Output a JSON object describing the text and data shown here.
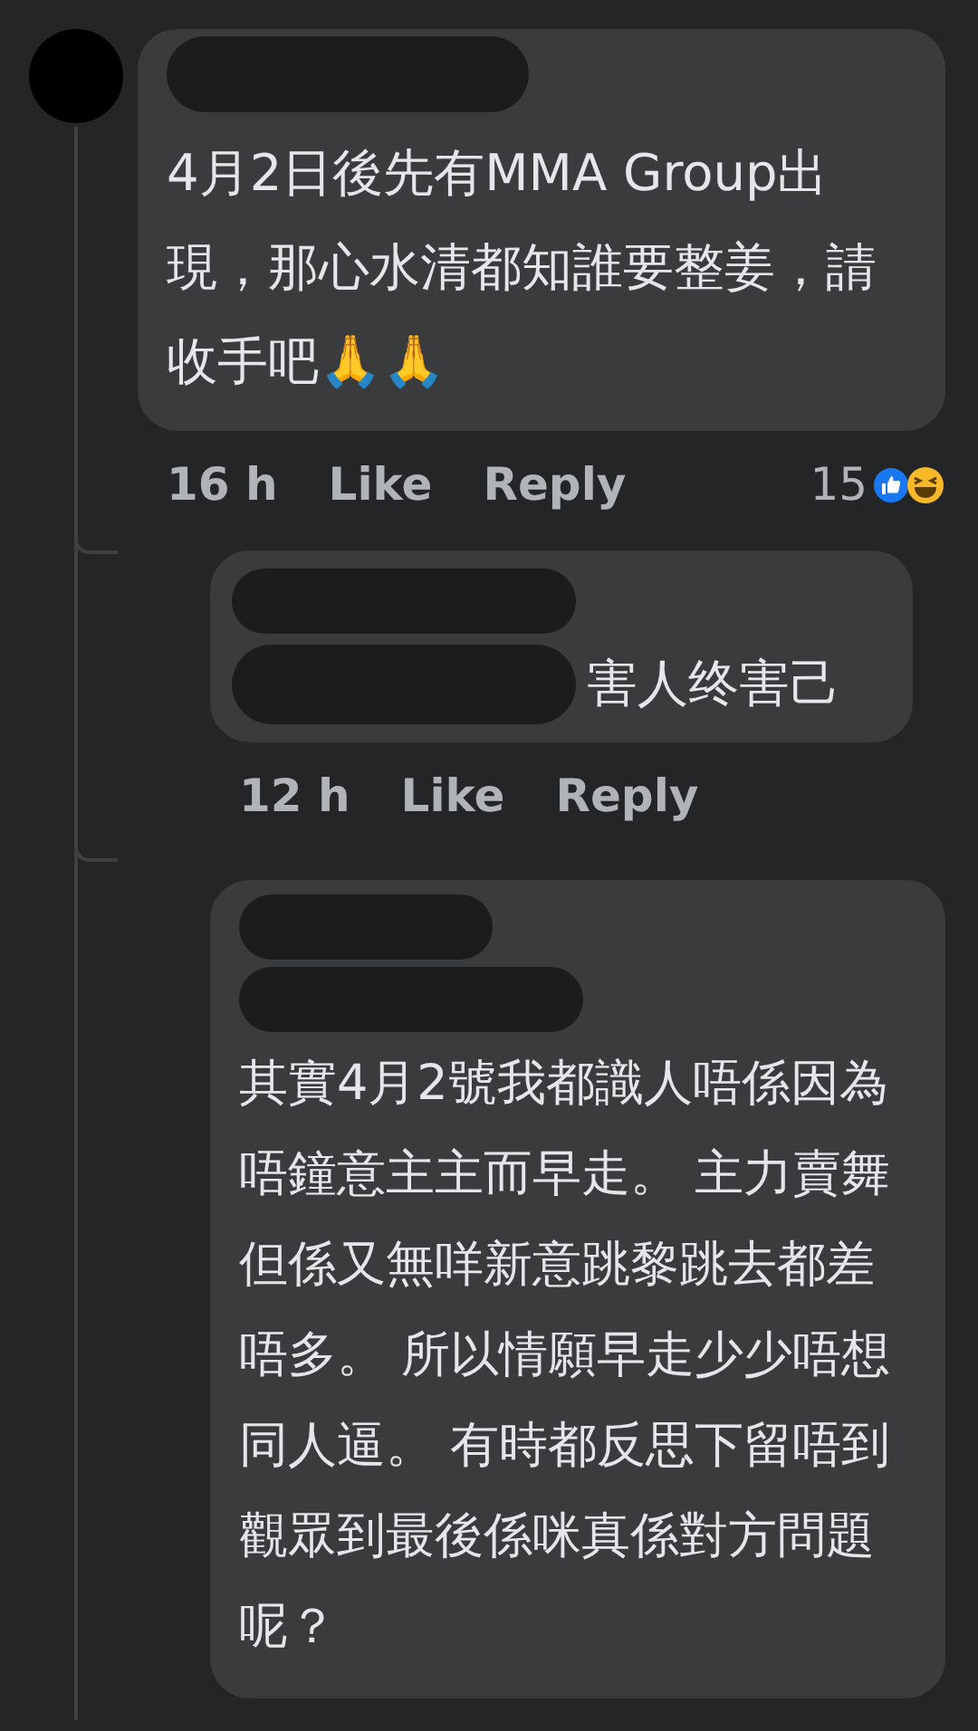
{
  "comments": [
    {
      "text": "4月2日後先有MMA Group出現，那心水清都知誰要整姜，請收手吧🙏🙏",
      "time": "16 h",
      "like": "Like",
      "reply": "Reply",
      "reaction_count": "15",
      "replies": [
        {
          "text": "害人终害己",
          "time": "12 h",
          "like": "Like",
          "reply": "Reply"
        },
        {
          "text": "其實4月2號我都識人唔係因為唔鐘意主主而早走。 主力賣舞但係又無咩新意跳黎跳去都差唔多。 所以情願早走少少唔想同人逼。 有時都反思下留唔到觀眾到最後係咪真係對方問題呢？"
        }
      ]
    }
  ]
}
